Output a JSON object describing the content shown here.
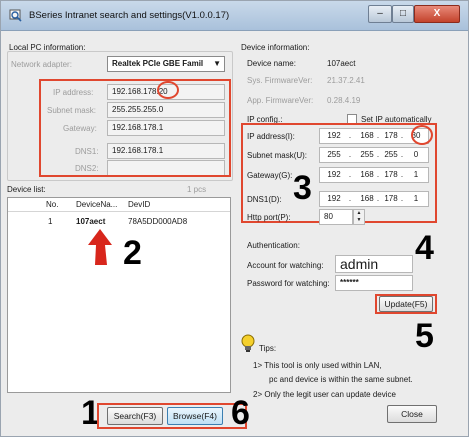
{
  "window": {
    "title": "BSeries Intranet search and settings(V1.0.0.17)",
    "min": "–",
    "max": "□",
    "close": "X"
  },
  "local_pc": {
    "group_label": "Local PC information:",
    "adapter_label": "Network adapter:",
    "adapter_value": "Realtek PCIe GBE Famil",
    "ip_label": "IP address:",
    "ip_value": "192.168.178.20",
    "mask_label": "Subnet mask:",
    "mask_value": "255.255.255.0",
    "gateway_label": "Gateway:",
    "gateway_value": "192.168.178.1",
    "dns1_label": "DNS1:",
    "dns1_value": "192.168.178.1",
    "dns2_label": "DNS2:",
    "dns2_value": ""
  },
  "device_list": {
    "label": "Device list:",
    "count": "1 pcs",
    "columns": [
      "No.",
      "DeviceNa...",
      "DevID"
    ],
    "rows": [
      {
        "no": "1",
        "name": "107aect",
        "id": "78A5DD000AD8"
      }
    ]
  },
  "device_info": {
    "group_label": "Device information:",
    "name_label": "Device name:",
    "name_value": "107aect",
    "sys_fw_label": "Sys. FirmwareVer:",
    "sys_fw_value": "21.37.2.41",
    "app_fw_label": "App. FirmwareVer:",
    "app_fw_value": "0.28.4.19",
    "ip_config_label": "IP config.:",
    "auto_ip_label": "Set IP automatically",
    "ip_label": "IP address(I):",
    "ip_octets": [
      "192",
      "168",
      "178",
      "30"
    ],
    "mask_label": "Subnet mask(U):",
    "mask_octets": [
      "255",
      "255",
      "255",
      "0"
    ],
    "gateway_label": "Gateway(G):",
    "gateway_octets": [
      "192",
      "168",
      "178",
      "1"
    ],
    "dns1_label": "DNS1(D):",
    "dns1_octets": [
      "192",
      "168",
      "178",
      "1"
    ],
    "http_label": "Http port(P):",
    "http_value": "80"
  },
  "auth": {
    "label": "Authentication:",
    "account_label": "Account for watching:",
    "account_value": "admin",
    "password_label": "Password for watching:",
    "password_value": "******"
  },
  "buttons": {
    "update": "Update(F5)",
    "search": "Search(F3)",
    "browse": "Browse(F4)",
    "close": "Close"
  },
  "tips": {
    "label": "Tips:",
    "line1": "1> This tool is only used within LAN,",
    "line2": "pc and device is within the same subnet.",
    "line3": "2> Only the legit user can update  device"
  },
  "annotations": {
    "n1": "1",
    "n2": "2",
    "n3": "3",
    "n4": "4",
    "n5": "5",
    "n6": "6"
  },
  "colors": {
    "annotation": "#e0472f",
    "titlebar": "#b7cce2",
    "close": "#c3432c"
  }
}
